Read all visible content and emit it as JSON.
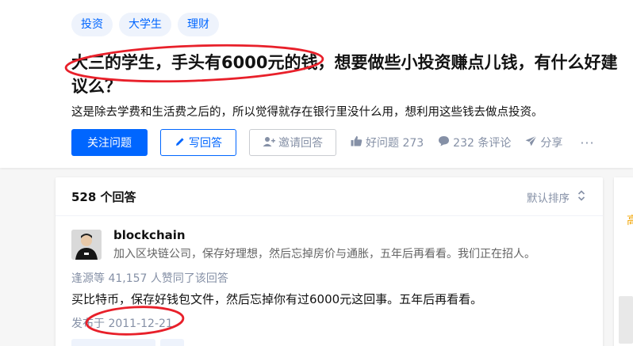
{
  "question": {
    "topics": [
      "投资",
      "大学生",
      "理财"
    ],
    "title": "大三的学生，手头有6000元的钱，想要做些小投资赚点儿钱，有什么好建议么？",
    "detail": "这是除去学费和生活费之后的，所以觉得就存在银行里没什么用，想利用这些钱去做点投资。",
    "follow_label": "关注问题",
    "answer_label": "写回答",
    "invite_label": "邀请回答",
    "good_question_label": "好问题 273",
    "comments_label": "232 条评论",
    "share_label": "分享",
    "more_label": "···"
  },
  "answers": {
    "count_label": "528 个回答",
    "sort_label": "默认排序",
    "first": {
      "author_name": "blockchain",
      "author_bio": "加入区块链公司，保存好理想，然后忘掉房价与通胀，五年后再看看。我们正在招人。",
      "voters": "逢源等 41,157 人赞同了该回答",
      "content": "买比特币，保存好钱包文件，然后忘掉你有过6000元这回事。五年后再看看。",
      "date": "发布于 2011-12-21"
    }
  },
  "sidebar": {
    "partial_char": "高"
  },
  "colors": {
    "brand_blue": "#0066ff",
    "annotation_red": "#e8202a",
    "muted": "#8590a6"
  },
  "icons": [
    "pencil-icon",
    "add-user-icon",
    "thumb-up-icon",
    "comment-icon",
    "share-icon",
    "sort-chevron-icon"
  ]
}
